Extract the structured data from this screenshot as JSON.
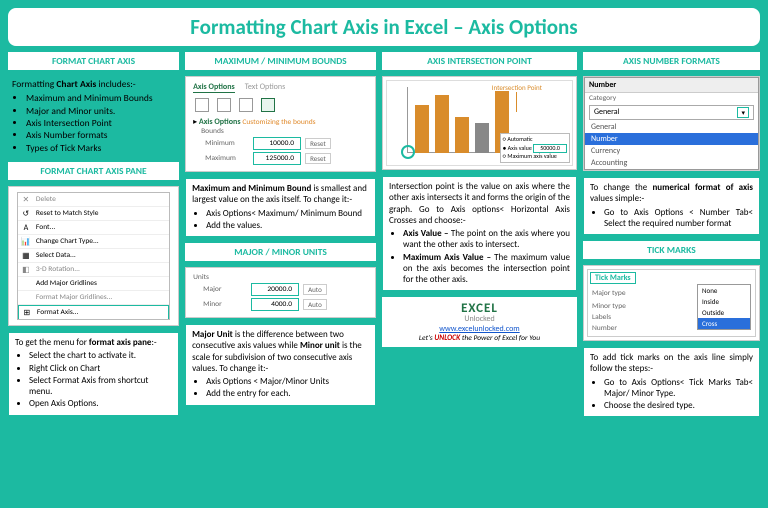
{
  "title": "Formatting Chart Axis in Excel – Axis Options",
  "headers": {
    "formatChartAxis": "FORMAT CHART AXIS",
    "formatPane": "FORMAT CHART AXIS PANE",
    "bounds": "MAXIMUM /  MINIMUM BOUNDS",
    "units": "MAJOR / MINOR UNITS",
    "intersection": "AXIS INTERSECTION POINT",
    "numberFormats": "AXIS NUMBER FORMATS",
    "tickMarks": "TICK MARKS"
  },
  "intro": {
    "lead": "Formatting Chart Axis includes:-",
    "boldWord": "Chart Axis",
    "items": [
      "Maximum and Minimum Bounds",
      "Major and Minor units.",
      "Axis Intersection Point",
      "Axis Number formats",
      "Types of Tick Marks"
    ]
  },
  "contextMenu": {
    "items": [
      "Delete",
      "Reset to Match Style",
      "Font...",
      "Change Chart Type...",
      "Select Data...",
      "3-D Rotation...",
      "Add Major Gridlines",
      "Format Major Gridlines...",
      "Format Axis..."
    ],
    "highlighted": "Format Axis..."
  },
  "paneCard": {
    "lead": "To get the menu for format axis pane:-",
    "boldPhrase": "format axis pane",
    "items": [
      "Select the chart to activate it.",
      "Right Click on Chart",
      "Select Format Axis from shortcut menu.",
      "Open Axis Options."
    ]
  },
  "axisOptionsPane": {
    "tabOn": "Axis Options",
    "tabOff": "Text Options",
    "groupTitle": "Axis Options",
    "custom": "Customizing the bounds",
    "boundsLabel": "Bounds",
    "minLabel": "Minimum",
    "maxLabel": "Maximum",
    "minVal": "10000.0",
    "maxVal": "125000.0",
    "reset": "Reset"
  },
  "boundsCard": {
    "leadBold": "Maximum and Minimum Bound",
    "leadRest": " is smallest and largest value on the axis itself. To change it:-",
    "items": [
      "Axis Options< Maximum/ Minimum Bound",
      "Add the values."
    ]
  },
  "unitsPane": {
    "label": "Units",
    "majorLabel": "Major",
    "minorLabel": "Minor",
    "majorVal": "20000.0",
    "minorVal": "4000.0",
    "auto": "Auto"
  },
  "unitsCard": {
    "t1a": "Major Unit",
    "t1b": " is the difference between two consecutive axis values while ",
    "t2a": "Minor unit",
    "t2b": " is the scale for subdivision of two consecutive axis values. To change it:-",
    "items": [
      "Axis Options < Major/Minor Units",
      "Add the entry for each."
    ]
  },
  "chartMock": {
    "ipLabel": "Intersection Point",
    "legend": {
      "auto": "Automatic",
      "axval": "Axis value",
      "axvalNum": "50000.0",
      "max": "Maximum axis value"
    }
  },
  "intersectionCard": {
    "lead": "Intersection point is the value on axis where the other axis intersects it and forms the origin of the graph. Go to Axis options< Horizontal Axis Crosses and choose:-",
    "i1a": "Axis Value –",
    "i1b": " The point on the axis where you want the other axis to intersect.",
    "i2a": "Maximum Axis Value –",
    "i2b": " The maximum value on the axis becomes the intersection point for the other axis."
  },
  "numDrop": {
    "title": "Number",
    "catLabel": "Category",
    "selected": "General",
    "options": [
      "General",
      "Number",
      "Currency",
      "Accounting"
    ],
    "highlighted": "Number"
  },
  "numberCard": {
    "t1": "To change the ",
    "t2": "numerical format of axis",
    "t3": " values simple:-",
    "items": [
      "Go to Axis Options < Number Tab< Select the required number format"
    ]
  },
  "tickPane": {
    "title": "Tick Marks",
    "majorType": "Major type",
    "minorType": "Minor type",
    "labels": "Labels",
    "number": "Number",
    "majorVal": "None",
    "menu": [
      "None",
      "Inside",
      "Outside",
      "Cross"
    ],
    "menuSel": "Cross"
  },
  "tickCard": {
    "lead": "To add tick marks on the axis line simply follow the steps:-",
    "items": [
      "Go to Axis Options< Tick Marks Tab< Major/ Minor Type.",
      "Choose the desired type."
    ]
  },
  "footer": {
    "logo1": "E",
    "logo2": "X",
    "logoRest": "CEL",
    "logoSub": "Unlocked",
    "url": "www.excelunlocked.com",
    "tag1": "Let's ",
    "tag2": "UNLOCK",
    "tag3": " the Power of Excel for You"
  }
}
